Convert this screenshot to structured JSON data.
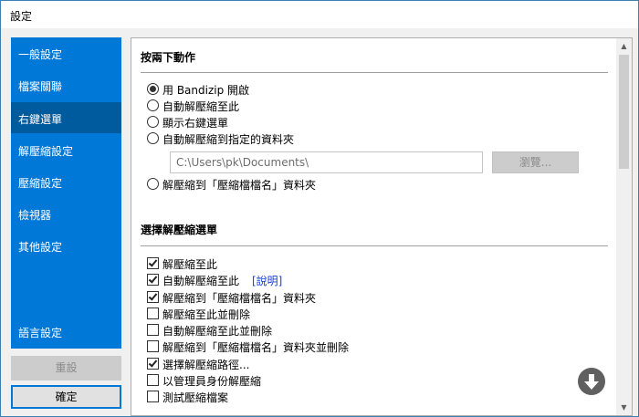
{
  "window": {
    "title": "設定"
  },
  "sidebar": {
    "items": [
      {
        "label": "一般設定",
        "active": false
      },
      {
        "label": "檔案關聯",
        "active": false
      },
      {
        "label": "右鍵選單",
        "active": true
      },
      {
        "label": "解壓縮設定",
        "active": false
      },
      {
        "label": "壓縮設定",
        "active": false
      },
      {
        "label": "檢視器",
        "active": false
      },
      {
        "label": "其他設定",
        "active": false
      }
    ],
    "language_label": "語言設定"
  },
  "buttons": {
    "reset": "重設",
    "ok": "確定"
  },
  "double_click": {
    "title": "按兩下動作",
    "options": [
      {
        "label": "用 Bandizip 開啟",
        "selected": true
      },
      {
        "label": "自動解壓縮至此",
        "selected": false
      },
      {
        "label": "顯示右鍵選單",
        "selected": false
      },
      {
        "label": "自動解壓縮到指定的資料夾",
        "selected": false
      },
      {
        "label": "解壓縮到「壓縮檔檔名」資料夾",
        "selected": false
      }
    ],
    "path_value": "C:\\Users\\pk\\Documents\\",
    "browse_label": "瀏覽..."
  },
  "extract_menu": {
    "title": "選擇解壓縮選單",
    "items": [
      {
        "label": "解壓縮至此",
        "checked": true
      },
      {
        "label": "自動解壓縮至此",
        "checked": true,
        "link": "[說明]"
      },
      {
        "label": "解壓縮到「壓縮檔檔名」資料夾",
        "checked": true
      },
      {
        "label": "解壓縮至此並刪除",
        "checked": false
      },
      {
        "label": "自動解壓縮至此並刪除",
        "checked": false
      },
      {
        "label": "解壓縮到「壓縮檔檔名」資料夾並刪除",
        "checked": false
      },
      {
        "label": "選擇解壓縮路徑...",
        "checked": true
      },
      {
        "label": "以管理員身份解壓縮",
        "checked": false
      },
      {
        "label": "測試壓縮檔案",
        "checked": false
      }
    ]
  },
  "icons": {
    "scroll_up": "arrow-up-icon",
    "scroll_down": "arrow-down-icon",
    "fab": "down-arrow-circle-icon"
  }
}
